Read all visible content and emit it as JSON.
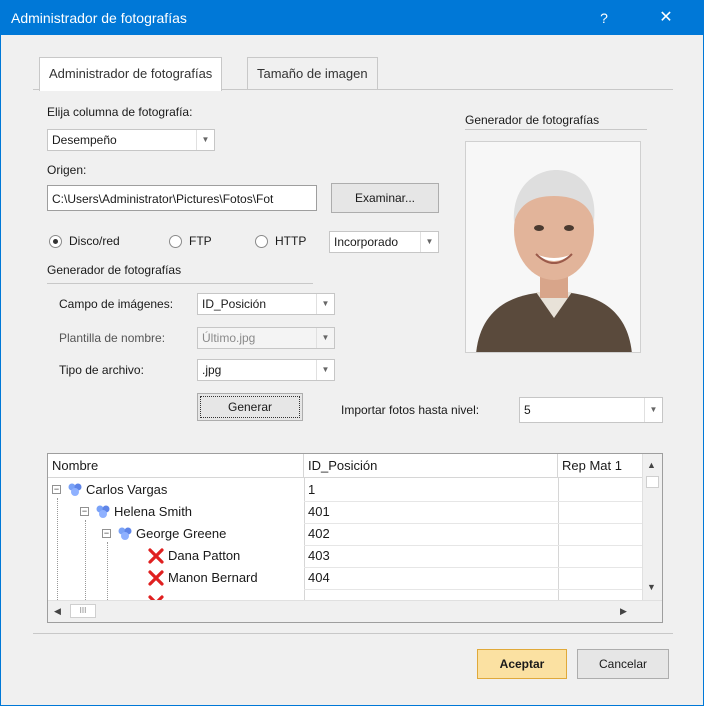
{
  "window": {
    "title": "Administrador de fotografías",
    "help_glyph": "?",
    "close_glyph": "✕"
  },
  "tabs": [
    {
      "label": "Administrador de fotografías",
      "active": true
    },
    {
      "label": "Tamaño de imagen",
      "active": false
    }
  ],
  "photo_column": {
    "label": "Elija columna de fotografía:",
    "value": "Desempeño"
  },
  "origin": {
    "label": "Origen:",
    "path": "C:\\Users\\Administrator\\Pictures\\Fotos\\Fot",
    "browse_label": "Examinar..."
  },
  "source": {
    "options": [
      {
        "label": "Disco/red",
        "checked": true
      },
      {
        "label": "FTP",
        "checked": false
      },
      {
        "label": "HTTP",
        "checked": false
      }
    ],
    "mode": "Incorporado"
  },
  "generator": {
    "heading": "Generador de fotografías",
    "image_field": {
      "label": "Campo de imágenes:",
      "value": "ID_Posición"
    },
    "name_template": {
      "label": "Plantilla de nombre:",
      "value": "Último.jpg"
    },
    "file_type": {
      "label": "Tipo de archivo:",
      "value": ".jpg"
    },
    "generate_label": "Generar"
  },
  "preview": {
    "heading": "Generador de fotografías"
  },
  "import_level": {
    "label": "Importar fotos hasta nivel:",
    "value": "5"
  },
  "tree": {
    "columns": [
      "Nombre",
      "ID_Posición",
      "Rep Mat 1"
    ],
    "rows": [
      {
        "name": "Carlos Vargas",
        "id": "1",
        "icon": "user-group-icon",
        "has_photo": true
      },
      {
        "name": "Helena Smith",
        "id": "401",
        "icon": "user-group-icon",
        "has_photo": true
      },
      {
        "name": "George Greene",
        "id": "402",
        "icon": "user-group-icon",
        "has_photo": true
      },
      {
        "name": "Dana Patton",
        "id": "403",
        "icon": "missing-photo-icon",
        "has_photo": false
      },
      {
        "name": "Manon Bernard",
        "id": "404",
        "icon": "missing-photo-icon",
        "has_photo": false
      }
    ],
    "hscroll_thumb": "III"
  },
  "footer": {
    "ok_label": "Aceptar",
    "cancel_label": "Cancelar"
  },
  "colors": {
    "titlebar": "#0078d7",
    "ok_button": "#fbe1a2",
    "folder_icon": "#6a8ff0",
    "missing_icon": "#e02020"
  }
}
